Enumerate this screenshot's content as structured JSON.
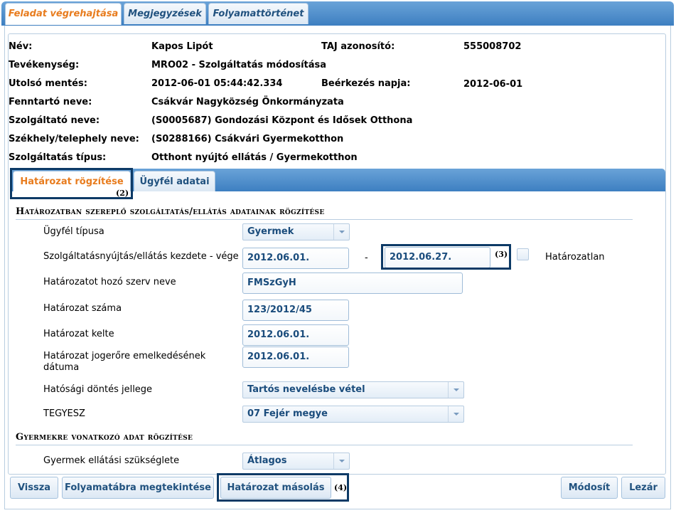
{
  "top_tabs": [
    {
      "label": "Feladat végrehajtása"
    },
    {
      "label": "Megjegyzések"
    },
    {
      "label": "Folyamattörténet"
    }
  ],
  "info": {
    "nev_label": "Név:",
    "nev_value": "Kapos Lipót",
    "taj_label": "TAJ azonosító:",
    "taj_value": "555008702",
    "tevekenyseg_label": "Tevékenység:",
    "tevekenyseg_value": "MRO02 - Szolgáltatás módosítása",
    "utolso_label": "Utolsó mentés:",
    "utolso_value": "2012-06-01 05:44:42.334",
    "beerkezes_label": "Beérkezés napja:",
    "beerkezes_value": "2012-06-01",
    "fenntarto_label": "Fenntartó neve:",
    "fenntarto_value": "Csákvár Nagyközség Önkormányzata",
    "szolgaltato_label": "Szolgáltató neve:",
    "szolgaltato_value": "(S0005687) Gondozási Központ és Idősek Otthona",
    "szekhely_label": "Székhely/telephely neve:",
    "szekhely_value": "(S0288166) Csákvári Gyermekotthon",
    "tipus_label": "Szolgáltatás típus:",
    "tipus_value": "Otthont nyújtó ellátás / Gyermekotthon"
  },
  "inner_tabs": [
    {
      "label": "Határozat rögzítése"
    },
    {
      "label": "Ügyfél adatai"
    }
  ],
  "annotations": {
    "a2": "(2)",
    "a3": "(3)",
    "a4": "(4)"
  },
  "section1": {
    "title": "Határozatban szereplő szolgáltatás/ellátás adatainak rögzítése"
  },
  "form": {
    "ugyfel_tipusa_label": "Ügyfél típusa",
    "ugyfel_tipusa_value": "Gyermek",
    "kezdete_vege_label": "Szolgáltatásnyújtás/ellátás kezdete - vége",
    "kezdete_value": "2012.06.01.",
    "dash": "-",
    "vege_value": "2012.06.27.",
    "hatarozatlan_label": "Határozatlan",
    "hozo_szerv_label": "Határozatot hozó szerv neve",
    "hozo_szerv_value": "FMSzGyH",
    "szama_label": "Határozat száma",
    "szama_value": "123/2012/45",
    "kelte_label": "Határozat kelte",
    "kelte_value": "2012.06.01.",
    "jogerore_label_1": "Határozat jogerőre emelkedésének",
    "jogerore_label_2": "dátuma",
    "jogerore_value": "2012.06.01.",
    "dontes_label": "Hatósági döntés jellege",
    "dontes_value": "Tartós nevelésbe vétel",
    "tegyesz_label": "TEGYESZ",
    "tegyesz_value": "07 Fejér megye"
  },
  "section2": {
    "title": "Gyermekre vonatkozó adat rögzítése"
  },
  "form2": {
    "szukseglet_label": "Gyermek ellátási szükséglete",
    "szukseglet_value": "Átlagos"
  },
  "buttons": {
    "vissza": "Vissza",
    "folyamatabra": "Folyamatábra megtekintése",
    "masolas": "Határozat másolás",
    "modosit": "Módosít",
    "lezar": "Lezár"
  }
}
